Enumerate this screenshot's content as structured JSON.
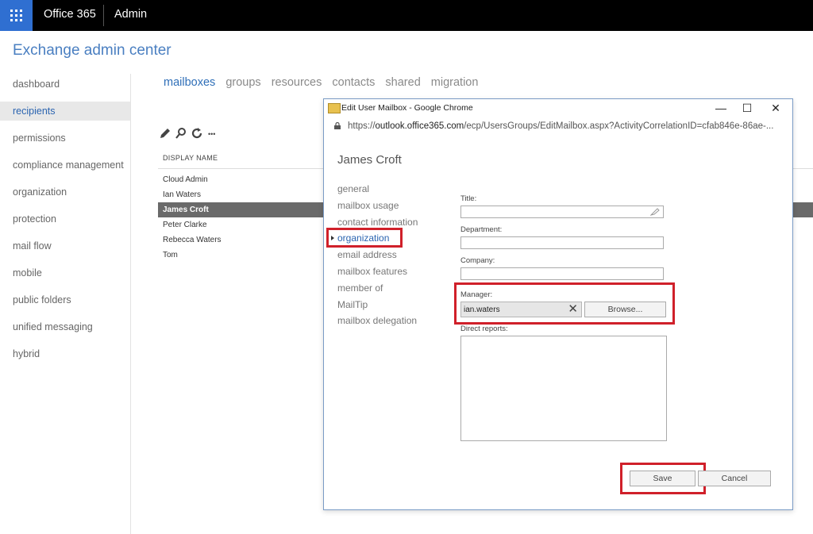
{
  "topbar": {
    "brand": "Office 365",
    "section": "Admin"
  },
  "header": {
    "title": "Exchange admin center"
  },
  "nav": {
    "items": [
      {
        "label": "dashboard"
      },
      {
        "label": "recipients",
        "active": true
      },
      {
        "label": "permissions"
      },
      {
        "label": "compliance management"
      },
      {
        "label": "organization"
      },
      {
        "label": "protection"
      },
      {
        "label": "mail flow"
      },
      {
        "label": "mobile"
      },
      {
        "label": "public folders"
      },
      {
        "label": "unified messaging"
      },
      {
        "label": "hybrid"
      }
    ]
  },
  "tabs": [
    {
      "label": "mailboxes",
      "active": true
    },
    {
      "label": "groups"
    },
    {
      "label": "resources"
    },
    {
      "label": "contacts"
    },
    {
      "label": "shared"
    },
    {
      "label": "migration"
    }
  ],
  "toolbar": {
    "icons": [
      "edit-icon",
      "search-icon",
      "refresh-icon",
      "more-icon"
    ],
    "more_label": "•••"
  },
  "list": {
    "header": "DISPLAY NAME",
    "rows": [
      "Cloud Admin",
      "Ian Waters",
      "James Croft",
      "Peter Clarke",
      "Rebecca Waters",
      "Tom"
    ],
    "selected_index": 2
  },
  "dialog": {
    "window_title": "Edit User Mailbox - Google Chrome",
    "controls": {
      "minimize": "—",
      "maximize": "☐",
      "close": "✕"
    },
    "url_prefix": "https://",
    "url_host": "outlook.office365.com",
    "url_path": "/ecp/UsersGroups/EditMailbox.aspx?ActivityCorrelationID=cfab846e-86ae-...",
    "user_name": "James Croft",
    "nav": [
      {
        "label": "general"
      },
      {
        "label": "mailbox usage"
      },
      {
        "label": "contact information"
      },
      {
        "label": "organization",
        "active": true
      },
      {
        "label": "email address"
      },
      {
        "label": "mailbox features"
      },
      {
        "label": "member of"
      },
      {
        "label": "MailTip"
      },
      {
        "label": "mailbox delegation"
      }
    ],
    "fields": {
      "title_label": "Title:",
      "title_value": "",
      "department_label": "Department:",
      "department_value": "",
      "company_label": "Company:",
      "company_value": "",
      "manager_label": "Manager:",
      "manager_value": "ian.waters",
      "clear_glyph": "✕",
      "browse_label": "Browse...",
      "direct_reports_label": "Direct reports:"
    },
    "buttons": {
      "save": "Save",
      "cancel": "Cancel"
    },
    "highlight_color": "#d0202a"
  },
  "colors": {
    "accent": "#2f6fb8",
    "waffle": "#2f6fd1",
    "topbar": "#000000",
    "selected_row": "#6a6a6a"
  }
}
